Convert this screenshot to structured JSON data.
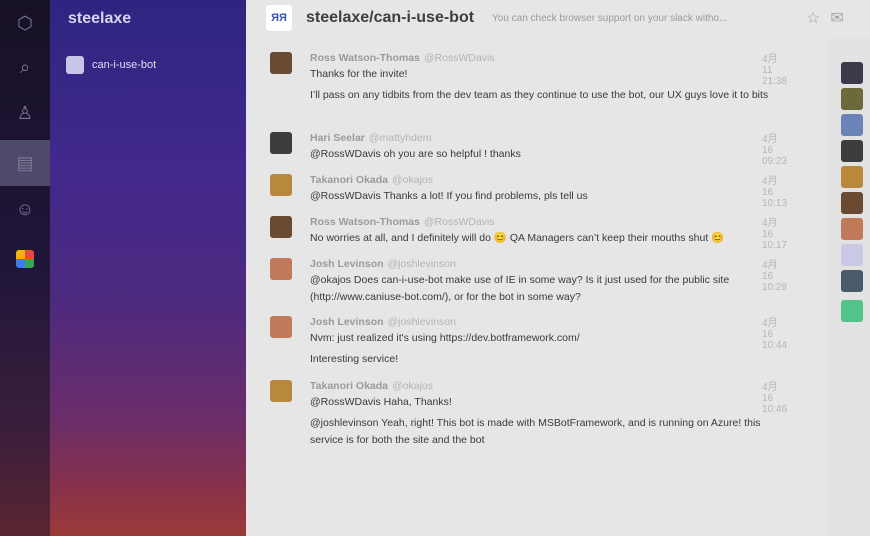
{
  "app": {
    "org_title": "steelaxe"
  },
  "sidebar": {
    "rail": [
      {
        "icon": "home-icon",
        "glyph": "⬡"
      },
      {
        "icon": "search-icon",
        "glyph": "⌕"
      },
      {
        "icon": "user-icon",
        "glyph": "♙"
      },
      {
        "icon": "rooms-icon",
        "glyph": "▤",
        "active": true
      },
      {
        "icon": "people-icon",
        "glyph": "☺"
      },
      {
        "icon": "apps-icon",
        "glyph": "■"
      }
    ],
    "rooms": [
      {
        "name": "can-i-use-bot"
      }
    ]
  },
  "header": {
    "title": "steelaxe/can-i-use-bot",
    "topic": "You can check browser support on your slack witho...",
    "avatar_text": "ЯЯ"
  },
  "colors": {
    "accent": "#4a78c8",
    "mention_bg": "#d4d4d4"
  },
  "messages": [
    {
      "author": "Ross Watson-Thomas",
      "handle": "@RossWDavis",
      "time": "4月 11 21:38",
      "lines": [
        "Thanks for the invite!",
        "I’ll pass on any tidbits from the dev team as they continue to use the bot, our UX guys love it to bits"
      ]
    },
    {
      "author": "Hari Seelar",
      "handle": "@mattyhdem",
      "time": "4月 16 09:23",
      "lines": [
        "@RossWDavis oh you are so helpful ! thanks"
      ]
    },
    {
      "author": "Takanori Okada",
      "handle": "@okajos",
      "time": "4月 16 10:13",
      "lines": [
        "@RossWDavis Thanks a lot! If you find problems, pls tell us"
      ]
    },
    {
      "author": "Ross Watson-Thomas",
      "handle": "@RossWDavis",
      "time": "4月 16 10:17",
      "lines": [
        "No worries at all, and I definitely will do 😊 QA Managers can’t keep their mouths shut 😊"
      ]
    },
    {
      "author": "Josh Levinson",
      "handle": "@joshlevinson",
      "time": "4月 16 10:28",
      "lines": [
        "@okajos Does can-i-use-bot make use of IE in some way? Is it just used for the public site (http://www.caniuse-bot.com/), or for the bot in some way?"
      ]
    },
    {
      "author": "Josh Levinson",
      "handle": "@joshlevinson",
      "time": "4月 16 10:44",
      "lines": [
        "Nvm: just realized it's using https://dev.botframework.com/",
        "Interesting service!"
      ]
    },
    {
      "author": "Takanori Okada",
      "handle": "@okajos",
      "time": "4月 16 10:46",
      "lines": [
        "@RossWDavis Haha, Thanks!",
        "@joshlevinson Yeah, right! This bot is made with MSBotFramework, and is running on Azure! this service is for both the site and the bot"
      ]
    }
  ]
}
